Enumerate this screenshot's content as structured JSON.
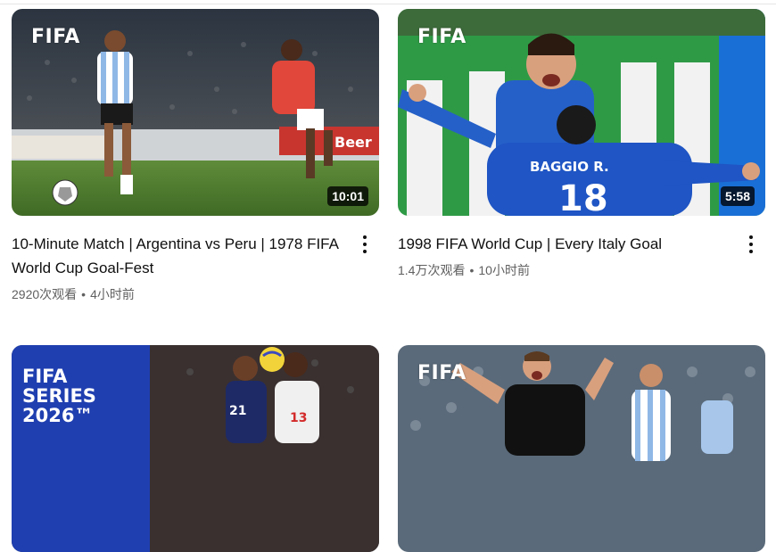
{
  "videos": [
    {
      "logo": "FIFA",
      "duration": "10:01",
      "title": "10-Minute Match | Argentina vs Peru | 1978 FIFA World Cup Goal-Fest",
      "views": "2920次观看",
      "age": "4小时前",
      "separator": "•",
      "thumb_desc": "Argentina vs Peru players on grass"
    },
    {
      "logo": "FIFA",
      "duration": "5:58",
      "title": "1998 FIFA World Cup | Every Italy Goal",
      "views": "1.4万次观看",
      "age": "10小时前",
      "separator": "•",
      "jersey_name": "BAGGIO R.",
      "jersey_number": "18",
      "thumb_desc": "Italy players celebrating"
    },
    {
      "logo_lines": [
        "FIFA",
        "SERIES",
        "2026™"
      ],
      "thumb_desc": "FIFA Series 2026 women's match"
    },
    {
      "logo": "FIFA",
      "thumb_desc": "Germany player shouting, Argentina player nearby"
    }
  ],
  "colors": {
    "title": "#0f0f0f",
    "meta": "#606060",
    "series_blue": "#1f3fb0"
  }
}
